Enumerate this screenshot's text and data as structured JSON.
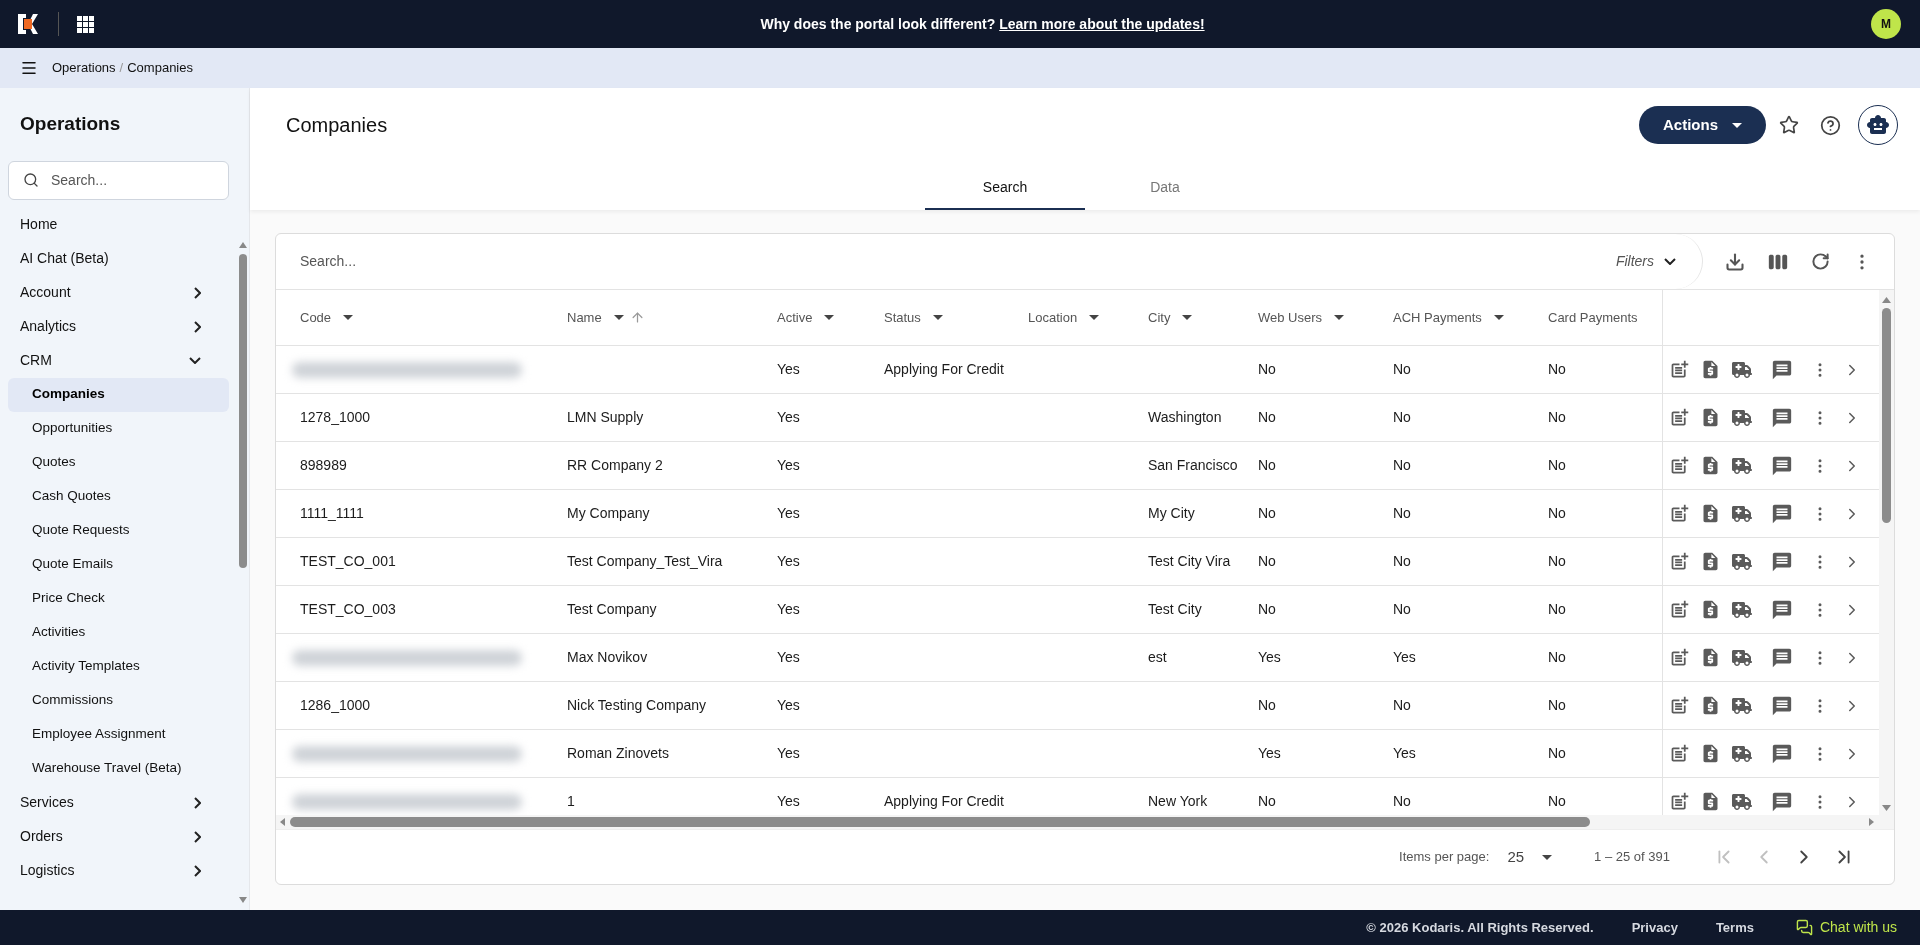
{
  "banner": {
    "text": "Why does the portal look different?",
    "link": "Learn more about the updates!"
  },
  "user": {
    "initial": "M"
  },
  "breadcrumb": [
    "Operations",
    "Companies"
  ],
  "breadcrumb_separator": "/",
  "sidebar": {
    "title": "Operations",
    "search_placeholder": "Search...",
    "items": [
      {
        "label": "Home",
        "selected": false
      },
      {
        "label": "AI Chat (Beta)",
        "selected": false
      },
      {
        "label": "Account",
        "expanded": false,
        "selected": false
      },
      {
        "label": "Analytics",
        "expanded": false,
        "selected": false
      },
      {
        "label": "CRM",
        "expanded": true,
        "selected": false,
        "children": [
          {
            "label": "Companies",
            "selected": true
          },
          {
            "label": "Opportunities",
            "selected": false
          },
          {
            "label": "Quotes",
            "selected": false
          },
          {
            "label": "Cash Quotes",
            "selected": false
          },
          {
            "label": "Quote Requests",
            "selected": false
          },
          {
            "label": "Quote Emails",
            "selected": false
          },
          {
            "label": "Price Check",
            "selected": false
          },
          {
            "label": "Activities",
            "selected": false
          },
          {
            "label": "Activity Templates",
            "selected": false
          },
          {
            "label": "Commissions",
            "selected": false
          },
          {
            "label": "Employee Assignment",
            "selected": false
          },
          {
            "label": "Warehouse Travel (Beta)",
            "selected": false
          }
        ]
      },
      {
        "label": "Services",
        "expanded": false,
        "selected": false
      },
      {
        "label": "Orders",
        "expanded": false,
        "selected": false
      },
      {
        "label": "Logistics",
        "expanded": false,
        "selected": false
      }
    ]
  },
  "page": {
    "title": "Companies",
    "actions_button": "Actions"
  },
  "tabs": [
    {
      "label": "Search",
      "selected": true
    },
    {
      "label": "Data",
      "selected": false
    }
  ],
  "table": {
    "search_placeholder": "Search...",
    "filters_label": "Filters",
    "columns": [
      {
        "label": "Code",
        "filter": true,
        "sorted": false
      },
      {
        "label": "Name",
        "filter": true,
        "sorted": true
      },
      {
        "label": "Active",
        "filter": true,
        "sorted": false
      },
      {
        "label": "Status",
        "filter": true,
        "sorted": false
      },
      {
        "label": "Location",
        "filter": true,
        "sorted": false
      },
      {
        "label": "City",
        "filter": true,
        "sorted": false
      },
      {
        "label": "Web Users",
        "filter": true,
        "sorted": false
      },
      {
        "label": "ACH Payments",
        "filter": true,
        "sorted": false
      },
      {
        "label": "Card Payments",
        "filter": false,
        "sorted": false
      }
    ],
    "rows": [
      {
        "code_redacted": true,
        "active": "Yes",
        "status": "Applying For Credit",
        "web_users": "No",
        "ach": "No",
        "card": "No"
      },
      {
        "code": "1278_1000",
        "name": "LMN Supply",
        "active": "Yes",
        "city": "Washington",
        "web_users": "No",
        "ach": "No",
        "card": "No"
      },
      {
        "code": "898989",
        "name": "RR Company 2",
        "active": "Yes",
        "city": "San Francisco",
        "web_users": "No",
        "ach": "No",
        "card": "No"
      },
      {
        "code": "1111_1111",
        "name": "My Company",
        "active": "Yes",
        "city": "My City",
        "web_users": "No",
        "ach": "No",
        "card": "No"
      },
      {
        "code": "TEST_CO_001",
        "name": "Test Company_Test_Vira",
        "active": "Yes",
        "city": "Test City Vira",
        "web_users": "No",
        "ach": "No",
        "card": "No"
      },
      {
        "code": "TEST_CO_003",
        "name": "Test Company",
        "active": "Yes",
        "city": "Test City",
        "web_users": "No",
        "ach": "No",
        "card": "No"
      },
      {
        "code_redacted": true,
        "name": "Max Novikov",
        "active": "Yes",
        "city": "est",
        "web_users": "Yes",
        "ach": "Yes",
        "card": "No"
      },
      {
        "code": "1286_1000",
        "name": "Nick Testing Company",
        "active": "Yes",
        "web_users": "No",
        "ach": "No",
        "card": "No"
      },
      {
        "code_redacted": true,
        "name": "Roman Zinovets",
        "active": "Yes",
        "web_users": "Yes",
        "ach": "Yes",
        "card": "No"
      },
      {
        "code_redacted": true,
        "name": "1",
        "active": "Yes",
        "status": "Applying For Credit",
        "city": "New York",
        "web_users": "No",
        "ach": "No",
        "card": "No"
      }
    ]
  },
  "pagination": {
    "label": "Items per page:",
    "page_size": "25",
    "range": "1 – 25 of 391",
    "first_disabled": true,
    "prev_disabled": true,
    "next_disabled": false,
    "last_disabled": false
  },
  "footer": {
    "copyright": "© 2026 Kodaris. All Rights Reserved.",
    "links": [
      "Privacy",
      "Terms"
    ],
    "chat": "Chat with us"
  }
}
